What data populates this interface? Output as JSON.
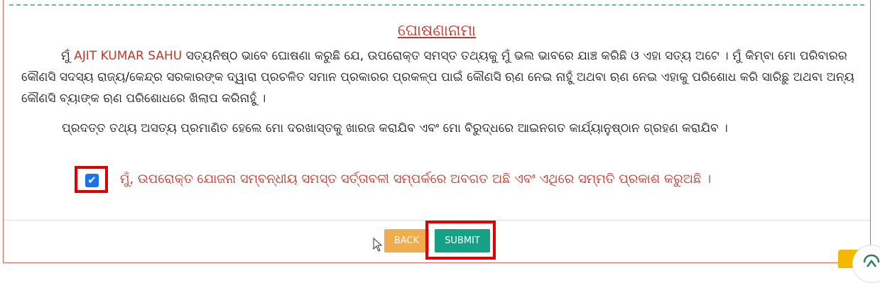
{
  "declaration": {
    "title": "ଘୋଷଣାନାମା",
    "para1_prefix": "ମୁଁ ",
    "applicant_name": "AJIT KUMAR SAHU",
    "para1_rest": " ସତ୍ୟନିଷ୍ଠ ଭାବେ ଘୋଷଣା କରୁଛି ଯେ, ଉପରୋକ୍ତ ସମସ୍ତ ତଥ୍ୟକୁ ମୁଁ ଭଲ ଭାବରେ ଯାଞ୍ଚ କରିଛି ଓ ଏହା ସତ୍ୟ ଅଟେ । ମୁଁ କିମ୍ବା ମୋ ପରିବାରର କୌଣସି ସଦସ୍ୟ ରାଜ୍ୟ/କେନ୍ଦ୍ର ସରକାରଙ୍କ ଦ୍ୱାରା ପ୍ରଚଳିତ ସମାନ ପ୍ରକାରର ପ୍ରକଳ୍ପ ପାଇଁ କୌଣସି ଋଣ ନେଇ ନାହୁଁ ଅଥବା ଋଣ ନେଇ ଏହାକୁ ପରିଶୋଧ କରି ସାରିଛୁ ଅଥବା ଅନ୍ୟ କୌଣସି ବ୍ୟାଙ୍କ ଋଣ ପରିଶୋଧରେ ଖିଲାପ କରିନାହୁଁ ।",
    "para2": "ପ୍ରଦତ୍ତ ତଥ୍ୟ ଅସତ୍ୟ ପ୍ରମାଣିତ ହେଲେ ମୋ ଦରଖାସ୍ତକୁ ଖାରଜ କରାଯିବ ଏବଂ ମୋ ବିରୁଦ୍ଧରେ ଆଇନଗତ କାର୍ଯ୍ୟାନୁଷ୍ଠାନ ଗ୍ରହଣ କରାଯିବ ।",
    "agree_checked": true,
    "agree_label": "ମୁଁ, ଉପରୋକ୍ତ ଯୋଜନା ସମ୍ବନ୍ଧୀୟ ସମସ୍ତ ସର୍ତ୍ତାବଳୀ ସମ୍ପର୍କରେ ଅବଗତ ଅଛି ଏବଂ ଏଥିରେ ସମ୍ମତି ପ୍ରକାଶ କରୁଅଛି ।"
  },
  "actions": {
    "back_label": "BACK",
    "submit_label": "SUBMIT"
  },
  "colors": {
    "accent_red": "#c0392b",
    "back": "#f0ad4e",
    "submit": "#16a085",
    "highlight": "#e00000"
  },
  "icons": {
    "checkbox": "check-icon",
    "cursor": "mouse-pointer-icon",
    "widget": "extension-icon"
  }
}
